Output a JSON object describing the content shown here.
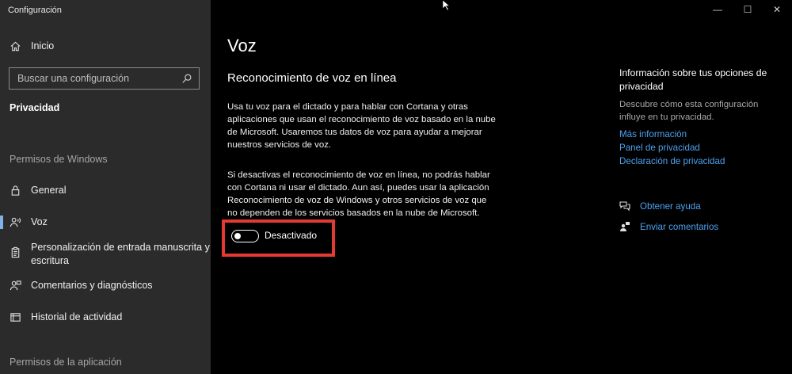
{
  "app": {
    "title": "Configuración"
  },
  "window": {
    "minimize": "—",
    "maximize": "☐",
    "close": "✕"
  },
  "sidebar": {
    "home_label": "Inicio",
    "search_placeholder": "Buscar una configuración",
    "current_section": "Privacidad",
    "group_windows": "Permisos de Windows",
    "group_app": "Permisos de la aplicación",
    "items": [
      {
        "label": "General",
        "icon": "lock-icon"
      },
      {
        "label": "Voz",
        "icon": "voice-icon",
        "active": true
      },
      {
        "label": "Personalización de entrada manuscrita y",
        "label2": "escritura",
        "icon": "clipboard-icon"
      },
      {
        "label": "Comentarios y diagnósticos",
        "icon": "feedback-icon"
      },
      {
        "label": "Historial de actividad",
        "icon": "history-icon"
      }
    ]
  },
  "main": {
    "page_title": "Voz",
    "section_title": "Reconocimiento de voz en línea",
    "para1": [
      "Usa tu voz para el dictado y para hablar con Cortana y otras",
      "aplicaciones que usan el reconocimiento de voz basado en la nube",
      "de Microsoft. Usaremos tus datos de voz para ayudar a mejorar",
      "nuestros servicios de voz."
    ],
    "para2": [
      "Si desactivas el reconocimiento de voz en línea, no podrás hablar",
      "con Cortana ni usar el dictado. Aun así, puedes usar la aplicación",
      "Reconocimiento de voz de Windows y otros servicios de voz que",
      "no dependen de los servicios basados en la nube de Microsoft."
    ],
    "toggle": {
      "label": "Desactivado",
      "state": "off"
    },
    "highlight_color": "#e53935"
  },
  "info": {
    "title": [
      "Información sobre tus opciones de",
      "privacidad"
    ],
    "desc": [
      "Descubre cómo esta configuración",
      "influye en tu privacidad."
    ],
    "links": [
      "Más información",
      "Panel de privacidad",
      "Declaración de privacidad"
    ],
    "help": "Obtener ayuda",
    "feedback": "Enviar comentarios",
    "link_color": "#4ea1ef"
  }
}
